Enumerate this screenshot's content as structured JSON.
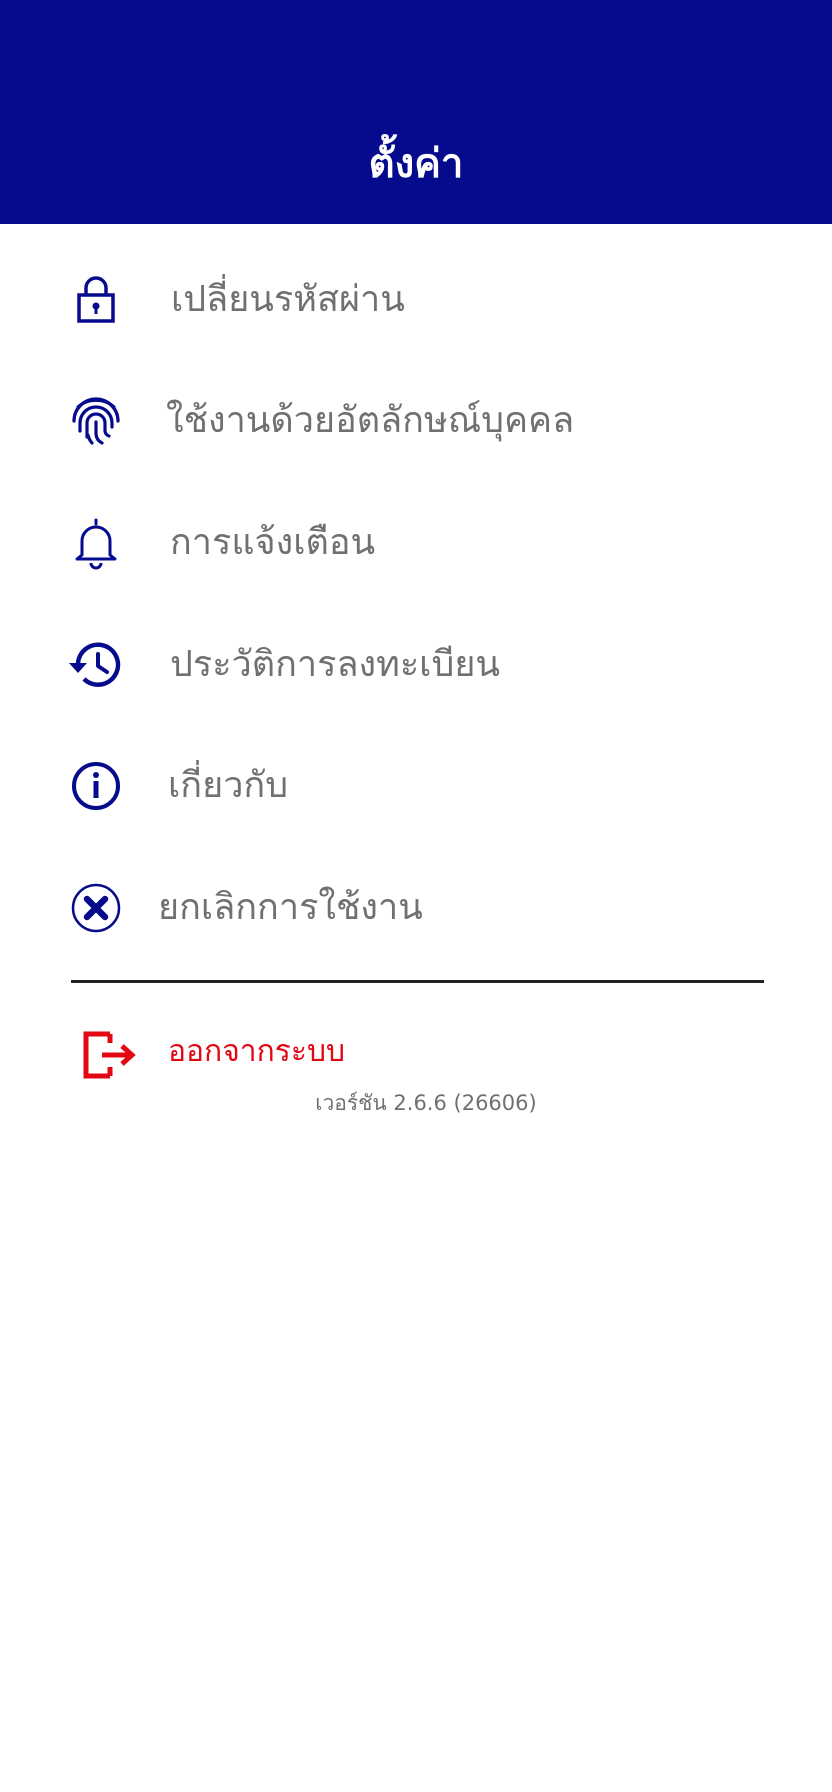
{
  "header": {
    "title": "ตั้งค่า",
    "background_color": "#050b8c"
  },
  "menu": {
    "items": [
      {
        "label": "เปลี่ยนรหัสผ่าน",
        "icon": "lock-icon"
      },
      {
        "label": "ใช้งานด้วยอัตลักษณ์บุคคล",
        "icon": "fingerprint-icon"
      },
      {
        "label": "การแจ้งเตือน",
        "icon": "bell-icon"
      },
      {
        "label": "ประวัติการลงทะเบียน",
        "icon": "history-icon"
      },
      {
        "label": "เกี่ยวกับ",
        "icon": "info-icon"
      },
      {
        "label": "ยกเลิกการใช้งาน",
        "icon": "cancel-x-icon"
      }
    ],
    "icon_color": "#050b8c",
    "label_color": "#707070"
  },
  "logout": {
    "label": "ออกจากระบบ",
    "icon": "logout-icon",
    "color": "#e30613"
  },
  "version": {
    "text": "เวอร์ชัน 2.6.6 (26606)"
  }
}
